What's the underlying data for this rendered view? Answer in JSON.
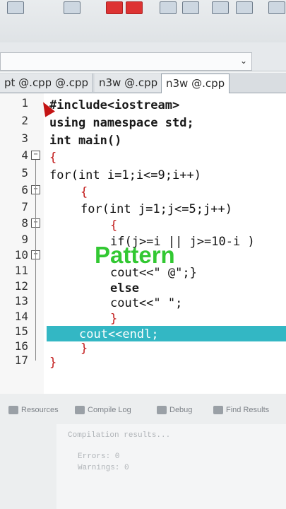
{
  "window": {
    "title": ""
  },
  "toolbar": {
    "icons": [
      "file-icon",
      "red-tool-icon",
      "red-tool-icon-2",
      "find-icon",
      "find-replace-icon",
      "doc-icon",
      "window-icon"
    ]
  },
  "tabs": [
    {
      "label": "pt @.cpp"
    },
    {
      "label": "@.cpp"
    },
    {
      "label": "n3w @.cpp"
    },
    {
      "label": "n3w @.cpp"
    }
  ],
  "editor": {
    "line_numbers": [
      "1",
      "2",
      "3",
      "4",
      "5",
      "6",
      "7",
      "8",
      "9",
      "10",
      "11",
      "12",
      "13",
      "14",
      "15",
      "16",
      "17"
    ],
    "lines": [
      "#include<iostream>",
      "using namespace std;",
      "int main()",
      "{",
      "for(int i=1;i<=9;i++)",
      "{",
      "for(int j=1;j<=5;j++)",
      "{",
      "if(j>=i || j>=10-i )",
      "cout<<\" @\";}",
      "else",
      "cout<<\" \";",
      "}",
      "cout<<endl;",
      "}",
      "}"
    ],
    "highlighted_line": 15
  },
  "overlay": {
    "watermark": "Pattern"
  },
  "bottom_panel": {
    "tabs": [
      {
        "label": "Resources"
      },
      {
        "label": "Compile Log"
      },
      {
        "label": "Debug"
      },
      {
        "label": "Find Results"
      }
    ],
    "log_lines": [
      "Compilation results...",
      "Errors: 0",
      "Warnings: 0"
    ]
  },
  "colors": {
    "highlight": "#33b7c4",
    "watermark": "#32c832",
    "operator": "#c21a1a",
    "number": "#1a2fbf"
  }
}
